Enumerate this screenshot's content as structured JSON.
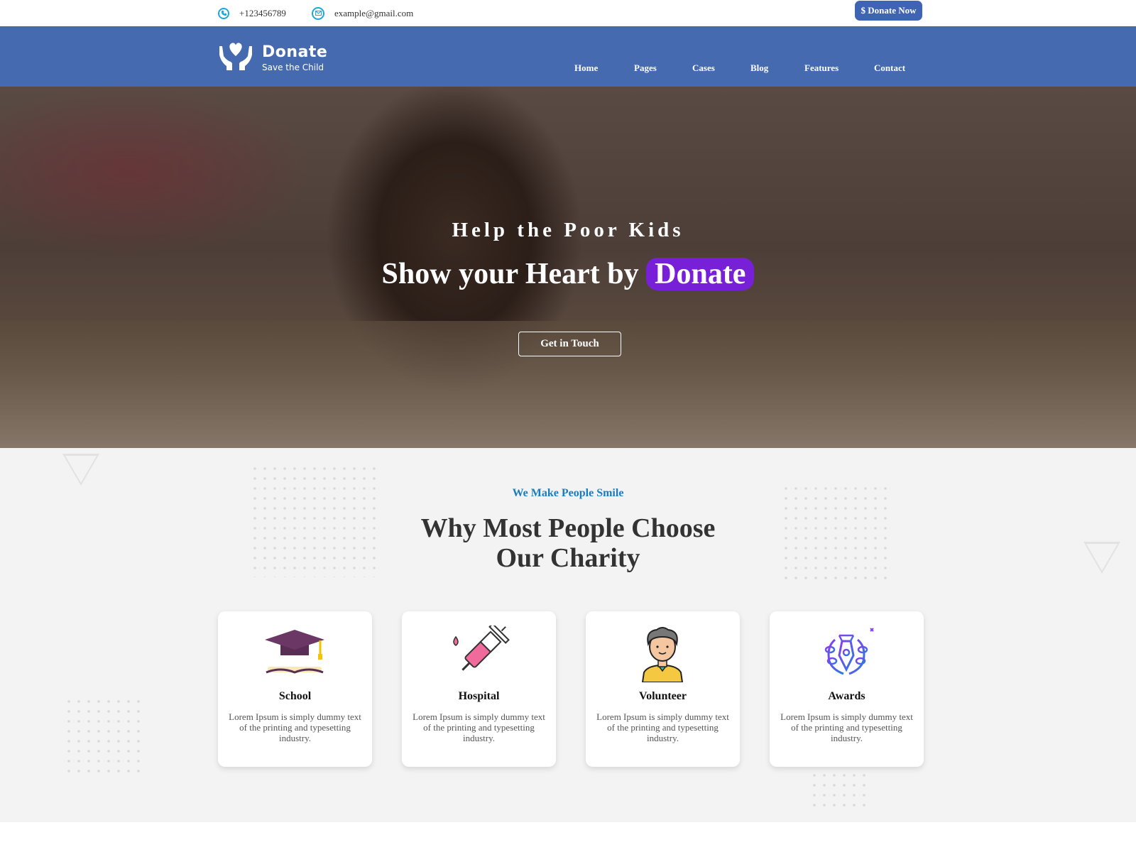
{
  "topbar": {
    "phone": "+123456789",
    "email": "example@gmail.com",
    "donate_button": "$ Donate Now",
    "phone_icon": "phone-icon",
    "email_icon": "mail-icon"
  },
  "logo": {
    "title": "Donate",
    "subtitle": "Save the Child",
    "icon": "heart-hands-icon"
  },
  "nav": {
    "items": [
      "Home",
      "Pages",
      "Cases",
      "Blog",
      "Features",
      "Contact"
    ]
  },
  "hero": {
    "subtitle": "Help the Poor Kids",
    "title_prefix": "Show your Heart by ",
    "title_highlight": "Donate",
    "button": "Get in Touch"
  },
  "section": {
    "tag": "We Make People Smile",
    "title_line1": "Why Most People Choose",
    "title_line2": "Our Charity",
    "cards": [
      {
        "title": "School",
        "text": "Lorem Ipsum is simply dummy text of the printing and typesetting industry.",
        "icon": "graduation-cap-icon"
      },
      {
        "title": "Hospital",
        "text": "Lorem Ipsum is simply dummy text of the printing and typesetting industry.",
        "icon": "syringe-icon"
      },
      {
        "title": "Volunteer",
        "text": "Lorem Ipsum is simply dummy text of the printing and typesetting industry.",
        "icon": "volunteer-person-icon"
      },
      {
        "title": "Awards",
        "text": "Lorem Ipsum is simply dummy text of the printing and typesetting industry.",
        "icon": "award-pen-icon"
      }
    ]
  },
  "colors": {
    "nav_bg": "#456aaf",
    "accent_blue": "#3f64b4",
    "highlight_purple": "#7820d8",
    "tag_blue": "#1c7cbd"
  }
}
